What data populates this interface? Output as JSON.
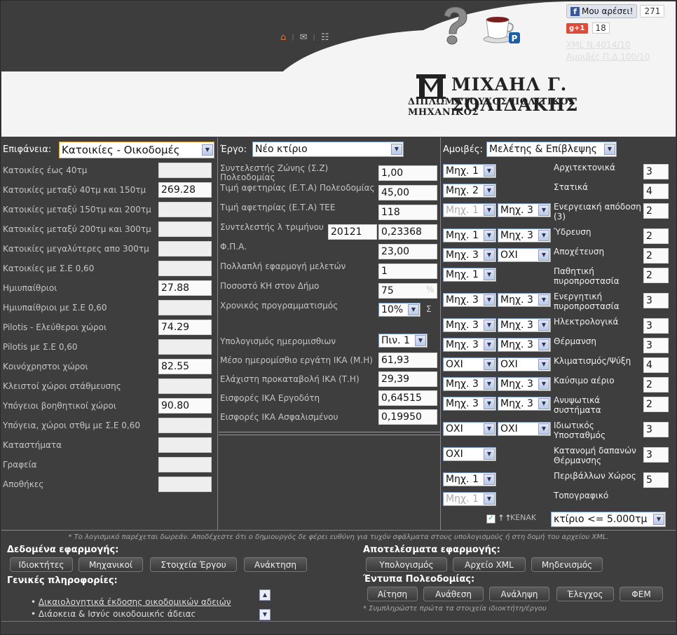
{
  "header": {
    "fb_like": "Μου αρέσει!",
    "fb_count": "271",
    "gplus": "+1",
    "gplus_count": "18",
    "link_xml": "XML N.4014/10",
    "link_fees": "Αμοιβές Π.Δ.100/10",
    "logo_name": "ΜΙΧΑΗΛ Γ. ΣΟΛΙΔΑΚΗΣ",
    "logo_sub": "ΔΙΠΛΩΜΑΤΟΥΧΟΣ ΠΟΛΙΤΙΚΟΣ ΜΗΧΑΝΙΚΟΣ",
    "icons": [
      "home-icon",
      "mail-icon",
      "sitemap-icon"
    ]
  },
  "col1": {
    "label": "Επιφάνεια:",
    "select": "Κατοικίες - Οικοδομές",
    "rows": [
      {
        "label": "Κατοικίες έως 40τμ",
        "value": ""
      },
      {
        "label": "Κατοικίες μεταξύ 40τμ και 150τμ",
        "value": "269.28"
      },
      {
        "label": "Κατοικίες μεταξύ 150τμ και 200τμ",
        "value": ""
      },
      {
        "label": "Κατοικίες μεταξύ 200τμ και 300τμ",
        "value": ""
      },
      {
        "label": "Κατοικίες μεγαλύτερες απο 300τμ",
        "value": ""
      },
      {
        "label": "Κατοικίες με Σ.Ε 0,60",
        "value": ""
      },
      {
        "label": "Ημιυπαίθριοι",
        "value": "27.88"
      },
      {
        "label": "Ημιυπαίθριοι με Σ.Ε 0,60",
        "value": ""
      },
      {
        "label": "Pilotis - Ελεύθεροι χώροι",
        "value": "74.29"
      },
      {
        "label": "Pilotis με Σ.Ε 0,60",
        "value": ""
      },
      {
        "label": "Κοινόχρηστοι χώροι",
        "value": "82.55"
      },
      {
        "label": "Κλειστοί χώροι στάθμευσης",
        "value": ""
      },
      {
        "label": "Υπόγειοι βοηθητικοί χώροι",
        "value": "90.80"
      },
      {
        "label": "Υπόγεια, χώροι στθμ με Σ.Ε 0,60",
        "value": ""
      },
      {
        "label": "Καταστήματα",
        "value": ""
      },
      {
        "label": "Γραφεία",
        "value": ""
      },
      {
        "label": "Αποθήκες",
        "value": ""
      }
    ]
  },
  "col2": {
    "label": "Έργο:",
    "select": "Νέο κτίριο",
    "rows": [
      {
        "label": "Συντελεστής Ζώνης (Σ.Ζ) Πολεοδομίας",
        "value": "1,00"
      },
      {
        "label": "Τιμή αφετηρίας (Ε.Τ.Α) Πολεοδομίας",
        "value": "45,00"
      },
      {
        "label": "Τιμή αφετηρίας (Ε.Τ.Α) ΤΕΕ",
        "value": "118"
      },
      {
        "label": "Συντελεστής λ τριμήνου",
        "extra": "20121",
        "value": "0,23368"
      },
      {
        "label": "Φ.Π.Α.",
        "value": "23,00"
      },
      {
        "label": "Πολλαπλή εφαρμογή μελετών",
        "value": "1"
      },
      {
        "label": "Ποσοστό ΚΗ στον Δήμο",
        "value": "75",
        "unit": "%"
      },
      {
        "label": "Χρονικός προγραμματισμός",
        "select": "10%",
        "unit": "Σ"
      }
    ],
    "rows2": [
      {
        "label": "Υπολογισμός ημερομισθιων",
        "select": "Πιν. 1"
      },
      {
        "label": "Μέσο ημερομίσθιο εργάτη ΙΚΑ (Μ.Η)",
        "value": "61,93"
      },
      {
        "label": "Ελάχιστη προκαταβολή ΙΚΑ (Τ.Η)",
        "value": "29,39"
      },
      {
        "label": "Εισφορές ΙΚΑ Εργοδότη",
        "value": "0,64515"
      },
      {
        "label": "Εισφορές ΙΚΑ Ασφαλισμένου",
        "value": "0,19950"
      }
    ]
  },
  "col3": {
    "label": "Αμοιβές:",
    "select": "Μελέτης & Επίβλεψης",
    "rows": [
      {
        "a": "Μηχ. 1",
        "b": "",
        "label": "Αρχιτεκτονικά",
        "value": "3"
      },
      {
        "a": "Μηχ. 2",
        "b": "",
        "label": "Στατικά",
        "value": "4"
      },
      {
        "a": "Μηχ. 1",
        "a_disabled": true,
        "b": "Μηχ. 3",
        "label": "Ενεργειακή απόδοση (3)",
        "value": "2"
      },
      {
        "a": "Μηχ. 1",
        "b": "Μηχ. 3",
        "label": "Ύδρευση",
        "value": "2"
      },
      {
        "a": "Μηχ. 3",
        "b": "ΟΧΙ",
        "label": "Αποχέτευση",
        "value": "2"
      },
      {
        "a": "Μηχ. 1",
        "b": "",
        "label": "Παθητική πυροπροστασία",
        "value": "2"
      },
      {
        "a": "Μηχ. 3",
        "b": "Μηχ. 3",
        "label": "Ενεργητική πυροπροστασία",
        "value": "3"
      },
      {
        "a": "Μηχ. 3",
        "b": "Μηχ. 3",
        "label": "Ηλεκτρολογικά",
        "value": "3"
      },
      {
        "a": "Μηχ. 3",
        "b": "Μηχ. 3",
        "label": "Θέρμανση",
        "value": "3"
      },
      {
        "a": "ΟΧΙ",
        "b": "ΟΧΙ",
        "label": "Κλιματισμός/Ψύξη",
        "value": "4"
      },
      {
        "a": "Μηχ. 3",
        "b": "Μηχ. 3",
        "label": "Καύσιμο αέριο",
        "value": "2"
      },
      {
        "a": "Μηχ. 3",
        "b": "Μηχ. 3",
        "label": "Ανυψωτικά συστήματα",
        "value": "2"
      },
      {
        "a": "ΟΧΙ",
        "b": "ΟΧΙ",
        "label": "Ιδιωτικός Υποσταθμός",
        "value": "3"
      },
      {
        "a": "ΟΧΙ",
        "b": "",
        "label": "Κατανομή δαπανών Θέρμανσης",
        "value": "3"
      },
      {
        "a": "Μηχ. 1",
        "b": "",
        "label": "Περιβάλλων Χώρος",
        "value": "5"
      },
      {
        "a": "Μηχ. 1",
        "a_disabled": true,
        "b": "",
        "label": "Τοπογραφικό",
        "value": ""
      }
    ],
    "kenak": "ΚΕΝΑΚ",
    "building_select": "κτίριο <= 5.000τμ"
  },
  "footer": {
    "disclaimer": "* Το λογισμικό παρέχεται δωρεάν. Αποδέχεστε ότι ο δημιουργός δε φέρει ευθύνη για τυχόν σφάλματα στους υπολογισμούς ή στη δομή του αρχείου XML.",
    "app_data": "Δεδομένα εφαρμογής:",
    "btn_owners": "Ιδιοκτήτες",
    "btn_engineers": "Μηχανικοί",
    "btn_project": "Στοιχεία Έργου",
    "btn_restore": "Ανάκτηση",
    "general": "Γενικές πληροφορίες:",
    "info_items": [
      "Δικαιολογητικά έκδοσης οικοδομικών αδειών",
      "Διάρκεια & Ισχύς οικοδομικής άδειας"
    ],
    "results": "Αποτελέσματα εφαρμογής:",
    "btn_calc": "Υπολογισμός",
    "btn_xml": "Αρχείο XML",
    "btn_reset": "Μηδενισμός",
    "forms": "Έντυπα Πολεοδομίας:",
    "btn_application": "Αίτηση",
    "btn_assignment": "Ανάθεση",
    "btn_acceptance": "Ανάληψη",
    "btn_check": "Έλεγχος",
    "btn_fem": "ΦΕΜ",
    "forms_note": "* Συμπληρώστε πρώτα τα στοιχεία ιδιοκτήτη/έργου"
  }
}
